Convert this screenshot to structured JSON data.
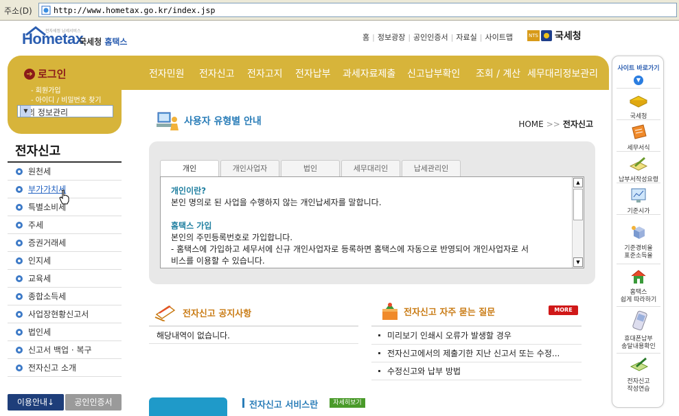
{
  "browser": {
    "address_label": "주소(D)",
    "url": "http://www.hometax.go.kr/index.jsp"
  },
  "header": {
    "logo_text": "Hometax",
    "logo_tagline": "전자세정 납세서비스",
    "logo_korean_prefix": "국세청",
    "logo_korean_name": "홈택스",
    "top_links": [
      "홈",
      "정보광장",
      "공인인증서",
      "자료실",
      "사이트맵"
    ],
    "nts_badge": "NTS",
    "nts_name": "국세청"
  },
  "main_nav": [
    "전자민원",
    "전자신고",
    "전자고지",
    "전자납부",
    "과세자료제출",
    "신고납부확인",
    "조회 / 계산",
    "세무대리정보관리"
  ],
  "login": {
    "title": "로그인",
    "links": [
      "- 회원가입",
      "- 아이디 / 비밀번호 찾기"
    ],
    "select_value": "나의 정보관리"
  },
  "sidebar": {
    "title": "전자신고",
    "items": [
      {
        "label": "원천세"
      },
      {
        "label": "부가가치세"
      },
      {
        "label": "특별소비세"
      },
      {
        "label": "주세"
      },
      {
        "label": "증권거래세"
      },
      {
        "label": "인지세"
      },
      {
        "label": "교육세"
      },
      {
        "label": "종합소득세"
      },
      {
        "label": "사업장현황신고서"
      },
      {
        "label": "법인세"
      },
      {
        "label": "신고서 백업 · 복구"
      },
      {
        "label": "전자신고 소개"
      }
    ],
    "btn_info": "이용안내↓",
    "btn_cert": "공인인증서"
  },
  "content": {
    "section_title": "사용자 유형별 안내",
    "breadcrumb_home": "HOME",
    "breadcrumb_sep": ">>",
    "breadcrumb_current": "전자신고",
    "tabs": [
      "개인",
      "개인사업자",
      "법인",
      "세무대리인",
      "납세관리인"
    ],
    "guide": {
      "q1": "개인이란?",
      "a1": "본인 명의로 된 사업을 수행하지 않는 개인납세자를 말합니다.",
      "q2": "홈택스 가입",
      "a2_1": "본인의 주민등록번호로 가입합니다.",
      "a2_2": "- 홈택스에 가입하고 세무서에 신규 개인사업자로 등록하면 홈택스에 자동으로 반영되어 개인사업자로 서",
      "a2_3": "비스를 이용할 수 있습니다."
    },
    "notice": {
      "title": "전자신고 공지사항",
      "empty": "해당내역이 없습니다."
    },
    "faq": {
      "title": "전자신고 자주 묻는 질문",
      "more": "MORE",
      "items": [
        "미리보기 인쇄시 오류가 발생할 경우",
        "전자신고에서의 제출기한 지난 신고서 또는 수정...",
        "수정신고와 납부 방법"
      ]
    },
    "service": {
      "title": "전자신고 서비스란",
      "detail_btn": "자세히보기"
    }
  },
  "quick": {
    "title": "사이트 바로가기",
    "items": [
      {
        "label": "국세청",
        "icon": "book-icon"
      },
      {
        "label": "세무서식",
        "icon": "form-icon"
      },
      {
        "label": "납부서작성요령",
        "icon": "write-icon"
      },
      {
        "label": "기준시가",
        "icon": "monitor-chart-icon"
      },
      {
        "label": "기준경비율\n표준소득율",
        "icon": "box-cube-icon"
      },
      {
        "label": "홈택스\n쉽게 따라하기",
        "icon": "house-icon"
      },
      {
        "label": "휴대폰납부\n송달내용확인",
        "icon": "mobile-phone-icon"
      },
      {
        "label": "전자신고\n작성연습",
        "icon": "pen-icon"
      }
    ]
  }
}
